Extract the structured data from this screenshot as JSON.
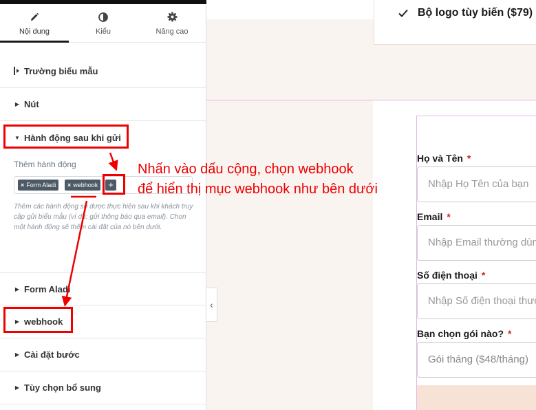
{
  "panel": {
    "tabs": [
      {
        "label": "Nội dung",
        "icon": "pencil-icon",
        "active": true
      },
      {
        "label": "Kiểu",
        "icon": "half-circle-icon",
        "active": false
      },
      {
        "label": "Nâng cao",
        "icon": "gear-icon",
        "active": false
      }
    ],
    "sections": {
      "form_fields": "Trường biểu mẫu",
      "button": "Nút",
      "actions_after_submit": "Hành động sau khi gửi",
      "form_aladi": "Form Aladi",
      "webhook": "webhook",
      "step_settings": "Cài đặt bước",
      "additional_options": "Tùy chọn bổ sung"
    },
    "actions": {
      "label": "Thêm hành động",
      "tags": [
        {
          "x": "×",
          "label": "Form Aladi"
        },
        {
          "x": "×",
          "label": "webhook"
        }
      ],
      "add_symbol": "+",
      "help": "Thêm các hành động sẽ được thực hiện sau khi khách truy cập gửi biểu mẫu (ví dụ: gửi thông báo qua email). Chọn một hành động sẽ thêm cài đặt của nó bên dưới."
    },
    "collapse_symbol": "‹"
  },
  "canvas": {
    "feature_text": "Bộ logo tùy biến ($79)",
    "form": [
      {
        "label": "Họ và Tên",
        "required": "*",
        "placeholder": "Nhập Họ Tên của bạn"
      },
      {
        "label": "Email",
        "required": "*",
        "placeholder": "Nhập Email thường dùng"
      },
      {
        "label": "Số điện thoại",
        "required": "*",
        "placeholder": "Nhập Số điện thoại thường dùng"
      },
      {
        "label": "Bạn chọn gói nào?",
        "required": "*",
        "placeholder": "Gói tháng ($48/tháng)"
      }
    ]
  },
  "annotation": {
    "line1": "Nhấn vào dấu cộng, chọn webhook",
    "line2": "để hiển thị mục webhook như bên dưới"
  },
  "colors": {
    "annotation_red": "#ee0000",
    "tag_bg": "#4d5a66",
    "canvas_beige": "#faf4f1",
    "required_red": "#d0262b"
  }
}
